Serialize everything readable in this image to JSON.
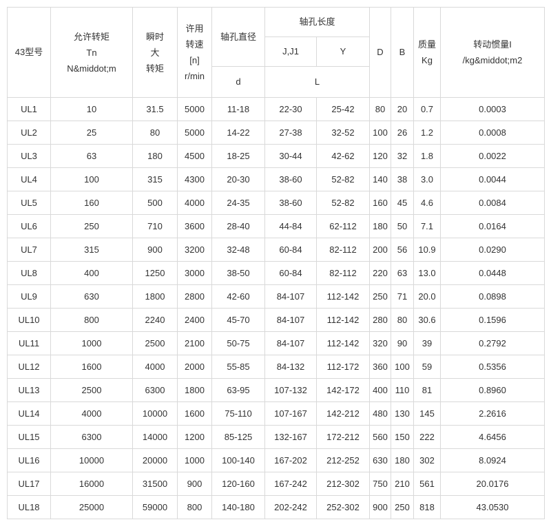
{
  "header": {
    "model": "43型号",
    "allow_torque": [
      "允许转矩",
      "Tn",
      "N&middot;m"
    ],
    "peak_torque": [
      "瞬时",
      "大",
      "转矩"
    ],
    "allow_speed": [
      "许用",
      "转速",
      "[n]",
      "r/min"
    ],
    "bore_dia": "轴孔直径",
    "bore_len": "轴孔长度",
    "jj1": "J,J1",
    "y": "Y",
    "D": "D",
    "B": "B",
    "mass": [
      "质量",
      "Kg"
    ],
    "inertia": [
      "转动惯量I",
      "/kg&middot;m2"
    ],
    "d": "d",
    "L": "L"
  },
  "rows": [
    [
      "UL1",
      "10",
      "31.5",
      "5000",
      "11-18",
      "22-30",
      "25-42",
      "80",
      "20",
      "0.7",
      "0.0003"
    ],
    [
      "UL2",
      "25",
      "80",
      "5000",
      "14-22",
      "27-38",
      "32-52",
      "100",
      "26",
      "1.2",
      "0.0008"
    ],
    [
      "UL3",
      "63",
      "180",
      "4500",
      "18-25",
      "30-44",
      "42-62",
      "120",
      "32",
      "1.8",
      "0.0022"
    ],
    [
      "UL4",
      "100",
      "315",
      "4300",
      "20-30",
      "38-60",
      "52-82",
      "140",
      "38",
      "3.0",
      "0.0044"
    ],
    [
      "UL5",
      "160",
      "500",
      "4000",
      "24-35",
      "38-60",
      "52-82",
      "160",
      "45",
      "4.6",
      "0.0084"
    ],
    [
      "UL6",
      "250",
      "710",
      "3600",
      "28-40",
      "44-84",
      "62-112",
      "180",
      "50",
      "7.1",
      "0.0164"
    ],
    [
      "UL7",
      "315",
      "900",
      "3200",
      "32-48",
      "60-84",
      "82-112",
      "200",
      "56",
      "10.9",
      "0.0290"
    ],
    [
      "UL8",
      "400",
      "1250",
      "3000",
      "38-50",
      "60-84",
      "82-112",
      "220",
      "63",
      "13.0",
      "0.0448"
    ],
    [
      "UL9",
      "630",
      "1800",
      "2800",
      "42-60",
      "84-107",
      "112-142",
      "250",
      "71",
      "20.0",
      "0.0898"
    ],
    [
      "UL10",
      "800",
      "2240",
      "2400",
      "45-70",
      "84-107",
      "112-142",
      "280",
      "80",
      "30.6",
      "0.1596"
    ],
    [
      "UL11",
      "1000",
      "2500",
      "2100",
      "50-75",
      "84-107",
      "112-142",
      "320",
      "90",
      "39",
      "0.2792"
    ],
    [
      "UL12",
      "1600",
      "4000",
      "2000",
      "55-85",
      "84-132",
      "112-172",
      "360",
      "100",
      "59",
      "0.5356"
    ],
    [
      "UL13",
      "2500",
      "6300",
      "1800",
      "63-95",
      "107-132",
      "142-172",
      "400",
      "110",
      "81",
      "0.8960"
    ],
    [
      "UL14",
      "4000",
      "10000",
      "1600",
      "75-110",
      "107-167",
      "142-212",
      "480",
      "130",
      "145",
      "2.2616"
    ],
    [
      "UL15",
      "6300",
      "14000",
      "1200",
      "85-125",
      "132-167",
      "172-212",
      "560",
      "150",
      "222",
      "4.6456"
    ],
    [
      "UL16",
      "10000",
      "20000",
      "1000",
      "100-140",
      "167-202",
      "212-252",
      "630",
      "180",
      "302",
      "8.0924"
    ],
    [
      "UL17",
      "16000",
      "31500",
      "900",
      "120-160",
      "167-242",
      "212-302",
      "750",
      "210",
      "561",
      "20.0176"
    ],
    [
      "UL18",
      "25000",
      "59000",
      "800",
      "140-180",
      "202-242",
      "252-302",
      "900",
      "250",
      "818",
      "43.0530"
    ]
  ]
}
